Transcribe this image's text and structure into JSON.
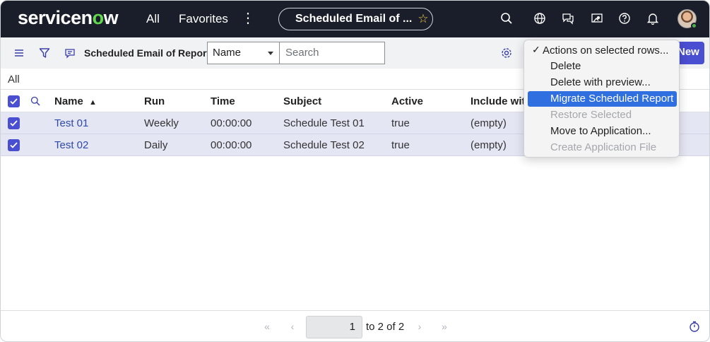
{
  "nav": {
    "logo_prefix": "servicen",
    "logo_o": "o",
    "logo_suffix": "w",
    "all": "All",
    "favorites": "Favorites",
    "more_icon": "⋮",
    "page_title": "Scheduled Email of ...",
    "star_icon": "☆",
    "icons": [
      "search-icon",
      "globe-icon",
      "chat-icon",
      "accessibility-icon",
      "help-icon",
      "bell-icon",
      "avatar"
    ]
  },
  "toolbar": {
    "list_title": "Scheduled Email of Reports",
    "search_field": "Name",
    "search_placeholder": "Search",
    "new_label": "New",
    "icons": [
      "hamburger-icon",
      "filter-icon",
      "list-context-icon",
      "gear-icon"
    ]
  },
  "breadcrumb": "All",
  "table": {
    "columns": [
      "Name",
      "Run",
      "Time",
      "Subject",
      "Active",
      "Include with"
    ],
    "sort_indicator": "▲",
    "rows": [
      {
        "name": "Test 01",
        "run": "Weekly",
        "time": "00:00:00",
        "subject": "Schedule Test 01",
        "active": "true",
        "include_with": "(empty)",
        "selected": true
      },
      {
        "name": "Test 02",
        "run": "Daily",
        "time": "00:00:00",
        "subject": "Schedule Test 02",
        "active": "true",
        "include_with": "(empty)",
        "selected": true
      }
    ]
  },
  "menu": {
    "header": "Actions on selected rows...",
    "check": "✓",
    "items": [
      {
        "label": "Delete",
        "state": "enabled"
      },
      {
        "label": "Delete with preview...",
        "state": "enabled"
      },
      {
        "label": "Migrate Scheduled Report",
        "state": "highlighted"
      },
      {
        "label": "Restore Selected",
        "state": "disabled"
      },
      {
        "label": "Move to Application...",
        "state": "enabled"
      },
      {
        "label": "Create Application File",
        "state": "disabled"
      }
    ]
  },
  "pagination": {
    "current_page": "1",
    "range_text": "to 2 of 2",
    "first_icon": "«",
    "prev_icon": "‹",
    "next_icon": "›",
    "last_icon": "»"
  },
  "colors": {
    "nav_bg": "#1a1e2a",
    "accent": "#4a4ed0",
    "selected_row": "#e5e6f4",
    "menu_highlight": "#2f6fe0",
    "link": "#2d4aa8"
  }
}
